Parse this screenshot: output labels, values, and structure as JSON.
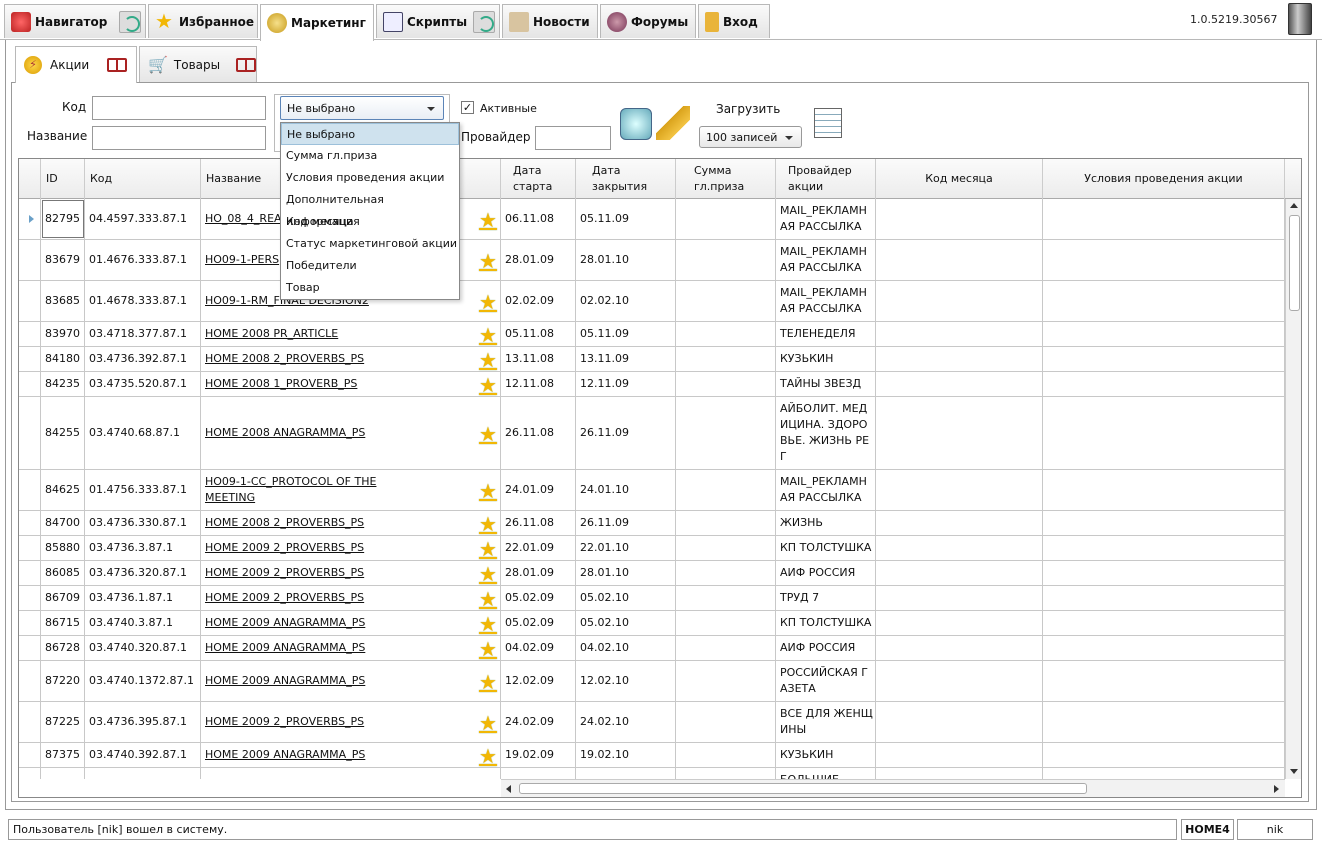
{
  "top_tabs": [
    {
      "label": "Навигатор",
      "icon": "megaphone-icon"
    },
    {
      "label": "Избранное",
      "icon": "star-icon"
    },
    {
      "label": "Маркетинг",
      "icon": "coin-icon"
    },
    {
      "label": "Скрипты",
      "icon": "script-icon"
    },
    {
      "label": "Новости",
      "icon": "news-icon"
    },
    {
      "label": "Форумы",
      "icon": "forum-icon"
    },
    {
      "label": "Вход",
      "icon": "door-icon"
    }
  ],
  "version": "1.0.5219.30567",
  "sub_tabs": [
    {
      "label": "Акции",
      "icon": "lightning-icon"
    },
    {
      "label": "Товары",
      "icon": "cart-icon"
    }
  ],
  "filters": {
    "code_label": "Код",
    "name_label": "Название",
    "field_combo_value": "Не выбрано",
    "active_label": "Активные",
    "active_checked": true,
    "provider_label": "Провайдер",
    "load_label": "Загрузить",
    "load_value": "100 записей",
    "dropdown_options": [
      "Не выбрано",
      "Сумма гл.приза",
      "Условия проведения акции",
      "Дополнительная информация",
      "Код месяца",
      "Статус маркетинговой акции",
      "Победители",
      "Товар"
    ]
  },
  "grid": {
    "columns": [
      "ID",
      "Код",
      "Название",
      "Дата старта",
      "Дата закрытия",
      "Сумма гл.приза",
      "Провайдер акции",
      "Код месяца",
      "Условия проведения акции"
    ],
    "rows": [
      {
        "id": "82795",
        "code": "04.4597.333.87.1",
        "name": "HO_08_4_REA",
        "start": "06.11.08",
        "end": "05.11.09",
        "provider": "MAIL_РЕКЛАМНАЯ РАССЫЛКА"
      },
      {
        "id": "83679",
        "code": "01.4676.333.87.1",
        "name": "HO09-1-PERS",
        "start": "28.01.09",
        "end": "28.01.10",
        "provider": "MAIL_РЕКЛАМНАЯ РАССЫЛКА"
      },
      {
        "id": "83685",
        "code": "01.4678.333.87.1",
        "name": "HO09-1-RM_FINAL DECISION2",
        "start": "02.02.09",
        "end": "02.02.10",
        "provider": "MAIL_РЕКЛАМНАЯ РАССЫЛКА"
      },
      {
        "id": "83970",
        "code": "03.4718.377.87.1",
        "name": "HOME 2008 PR_ARTICLE",
        "start": "05.11.08",
        "end": "05.11.09",
        "provider": "ТЕЛЕНЕДЕЛЯ"
      },
      {
        "id": "84180",
        "code": "03.4736.392.87.1",
        "name": "HOME 2008 2_PROVERBS_PS",
        "start": "13.11.08",
        "end": "13.11.09",
        "provider": "КУЗЬКИН"
      },
      {
        "id": "84235",
        "code": "03.4735.520.87.1",
        "name": "HOME 2008 1_PROVERB_PS",
        "start": "12.11.08",
        "end": "12.11.09",
        "provider": "ТАЙНЫ ЗВЕЗД"
      },
      {
        "id": "84255",
        "code": "03.4740.68.87.1",
        "name": "HOME 2008 ANAGRAMMA_PS",
        "start": "26.11.08",
        "end": "26.11.09",
        "provider": "АЙБОЛИТ. МЕДИЦИНА. ЗДОРОВЬЕ. ЖИЗНЬ РЕГ"
      },
      {
        "id": "84625",
        "code": "01.4756.333.87.1",
        "name": "HO09-1-CC_PROTOCOL OF THE MEETING",
        "start": "24.01.09",
        "end": "24.01.10",
        "provider": "MAIL_РЕКЛАМНАЯ РАССЫЛКА"
      },
      {
        "id": "84700",
        "code": "03.4736.330.87.1",
        "name": "HOME 2008 2_PROVERBS_PS",
        "start": "26.11.08",
        "end": "26.11.09",
        "provider": "ЖИЗНЬ"
      },
      {
        "id": "85880",
        "code": "03.4736.3.87.1",
        "name": "HOME 2009 2_PROVERBS_PS",
        "start": "22.01.09",
        "end": "22.01.10",
        "provider": "КП ТОЛСТУШКА"
      },
      {
        "id": "86085",
        "code": "03.4736.320.87.1",
        "name": "HOME 2009 2_PROVERBS_PS",
        "start": "28.01.09",
        "end": "28.01.10",
        "provider": "АИФ РОССИЯ"
      },
      {
        "id": "86709",
        "code": "03.4736.1.87.1",
        "name": "HOME 2009 2_PROVERBS_PS",
        "start": "05.02.09",
        "end": "05.02.10",
        "provider": "ТРУД 7"
      },
      {
        "id": "86715",
        "code": "03.4740.3.87.1",
        "name": "HOME 2009 ANAGRAMMA_PS",
        "start": "05.02.09",
        "end": "05.02.10",
        "provider": "КП ТОЛСТУШКА"
      },
      {
        "id": "86728",
        "code": "03.4740.320.87.1",
        "name": "HOME 2009 ANAGRAMMA_PS",
        "start": "04.02.09",
        "end": "04.02.10",
        "provider": "АИФ РОССИЯ"
      },
      {
        "id": "87220",
        "code": "03.4740.1372.87.1",
        "name": "HOME 2009 ANAGRAMMA_PS",
        "start": "12.02.09",
        "end": "12.02.10",
        "provider": "РОССИЙСКАЯ ГАЗЕТА"
      },
      {
        "id": "87225",
        "code": "03.4736.395.87.1",
        "name": "HOME 2009 2_PROVERBS_PS",
        "start": "24.02.09",
        "end": "24.02.10",
        "provider": "ВСЕ ДЛЯ ЖЕНЩИНЫ"
      },
      {
        "id": "87375",
        "code": "03.4740.392.87.1",
        "name": "HOME 2009 ANAGRAMMA_PS",
        "start": "19.02.09",
        "end": "19.02.10",
        "provider": "КУЗЬКИН"
      },
      {
        "id": "",
        "code": "",
        "name": "",
        "start": "",
        "end": "",
        "provider": "БОЛЬШИЕ"
      }
    ]
  },
  "status": {
    "message": "Пользователь [nik] вошел в систему.",
    "machine": "HOME4",
    "user": "nik"
  }
}
